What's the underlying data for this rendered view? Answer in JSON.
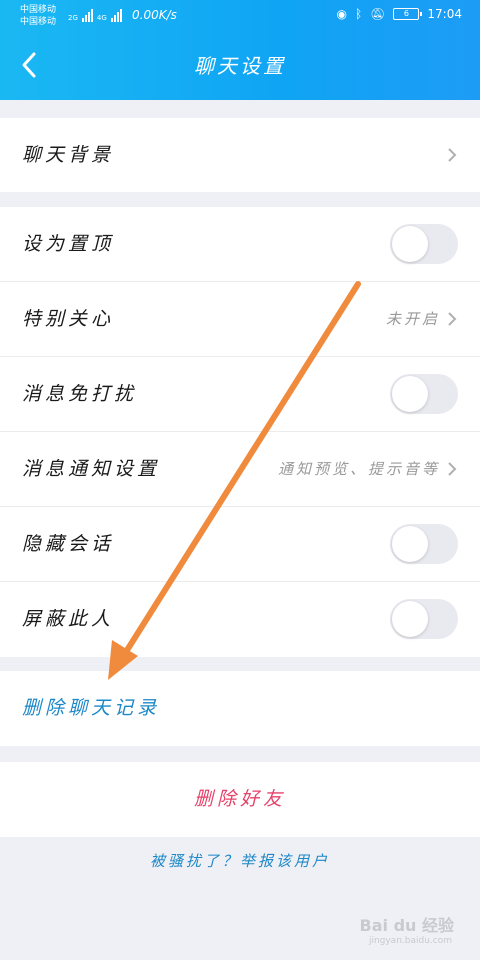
{
  "status_bar": {
    "carrier_1": "中国移动",
    "carrier_2": "中国移动",
    "network_1": "2G",
    "network_2": "4G",
    "speed": "0.00K/s",
    "battery": "6",
    "time": "17:04"
  },
  "header": {
    "title": "聊天设置",
    "back_icon": "chevron-left-icon"
  },
  "section_background": {
    "label": "聊天背景"
  },
  "settings": [
    {
      "label": "设为置顶",
      "control": "toggle",
      "on": false
    },
    {
      "label": "特别关心",
      "control": "chevron",
      "value": "未开启"
    },
    {
      "label": "消息免打扰",
      "control": "toggle",
      "on": false
    },
    {
      "label": "消息通知设置",
      "control": "chevron",
      "value": "通知预览、提示音等"
    },
    {
      "label": "隐藏会话",
      "control": "toggle",
      "on": false
    },
    {
      "label": "屏蔽此人",
      "control": "toggle",
      "on": false
    }
  ],
  "delete_history": {
    "label": "删除聊天记录"
  },
  "delete_friend": {
    "label": "删除好友"
  },
  "report": {
    "label": "被骚扰了？举报该用户"
  },
  "watermark": {
    "brand": "Bai du 经验",
    "sub": "jingyan.baidu.com"
  },
  "colors": {
    "header": "#10a4f4",
    "link": "#1d88c8",
    "danger": "#e6436a",
    "annotation_arrow": "#f08a3c"
  }
}
